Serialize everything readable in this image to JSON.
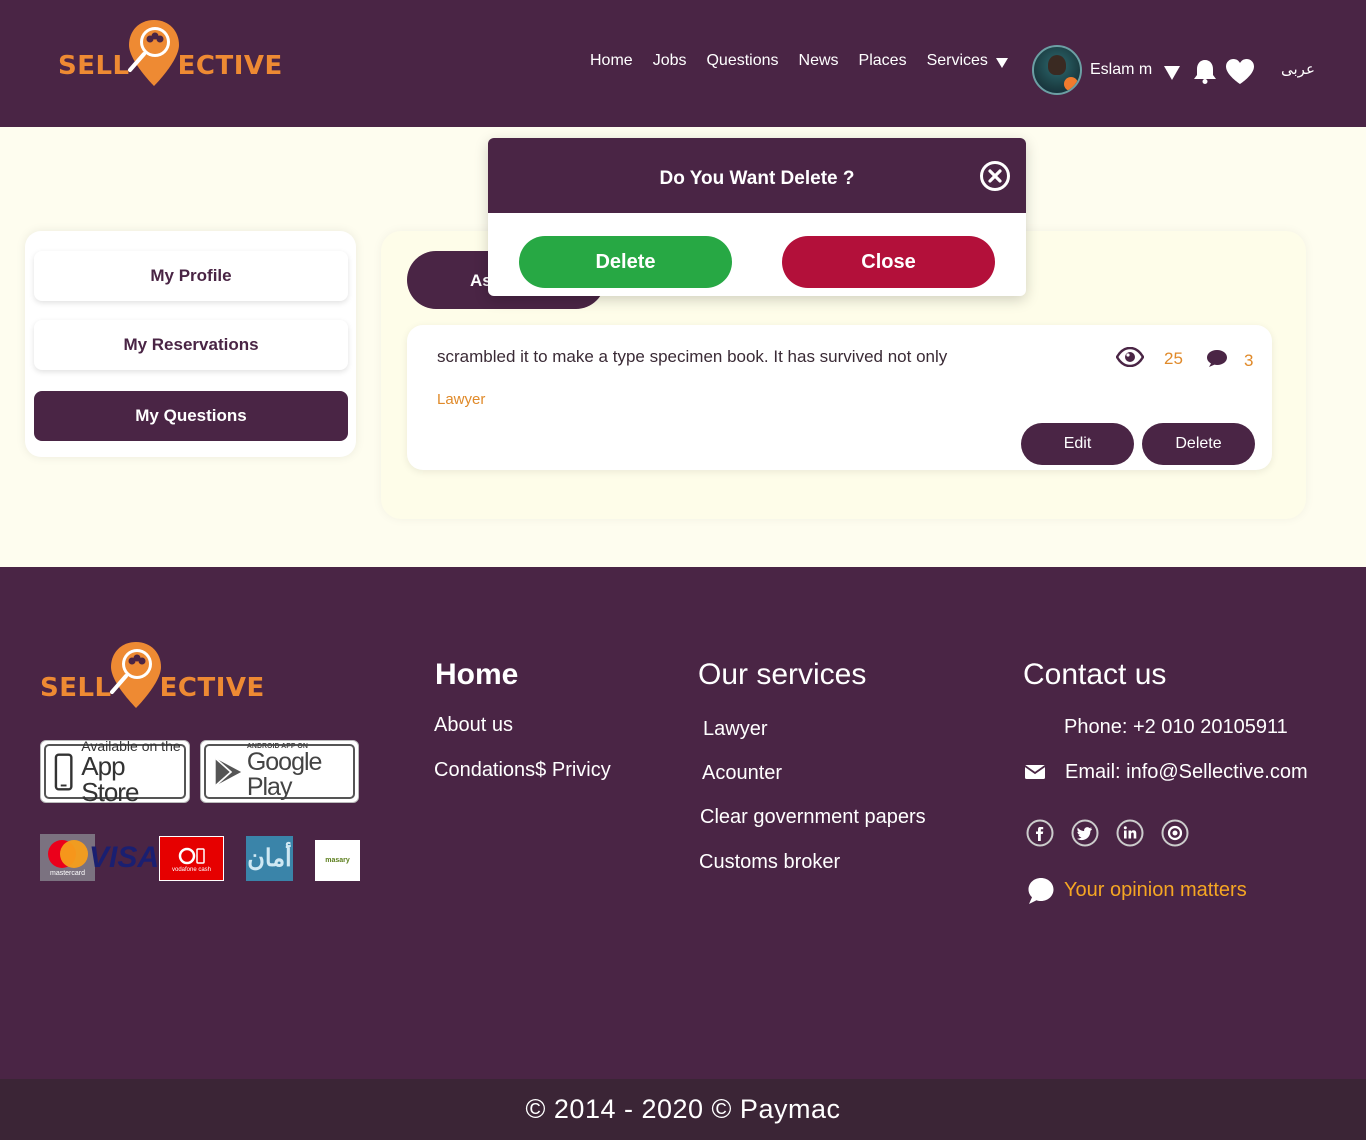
{
  "brand": {
    "left": "SELL",
    "right": "ECTIVE",
    "accent": "#ee8a33",
    "primary": "#4a2545"
  },
  "nav": {
    "items": [
      "Home",
      "Jobs",
      "Questions",
      "News",
      "Places",
      "Services"
    ],
    "user_name": "Eslam m",
    "language": "عربى"
  },
  "sidebar": {
    "items": [
      {
        "label": "My Profile"
      },
      {
        "label": "My Reservations"
      },
      {
        "label": "My Questions",
        "active": true
      }
    ]
  },
  "main": {
    "tab_label": "As",
    "question": {
      "text": "scrambled it to make a type specimen book. It has survived not only",
      "category": "Lawyer",
      "views": "25",
      "comments": "3",
      "edit_label": "Edit",
      "delete_label": "Delete"
    }
  },
  "modal": {
    "title": "Do You Want Delete ?",
    "delete_label": "Delete",
    "close_label": "Close"
  },
  "footer": {
    "apps": {
      "appstore_top": "Available on the",
      "appstore_main": "App Store",
      "google_top": "ANDROID APP ON",
      "google_main": "Google Play"
    },
    "payments": {
      "mastercard": "mastercard",
      "visa": "VISA",
      "vodafone": "vodafone cash",
      "aman": "أمان",
      "masary": "masary"
    },
    "home": {
      "title": "Home",
      "links": [
        "About us",
        "Condations$ Privicy"
      ]
    },
    "services": {
      "title": "Our services",
      "links": [
        "Lawyer",
        "Acounter",
        "Clear government papers",
        "Customs broker"
      ]
    },
    "contact": {
      "title": "Contact us",
      "phone": "Phone: +2 010 20105911",
      "email": "Email: info@Sellective.com",
      "opinion": "Your opinion matters"
    },
    "copyright": "© 2014 - 2020 © Paymac"
  }
}
